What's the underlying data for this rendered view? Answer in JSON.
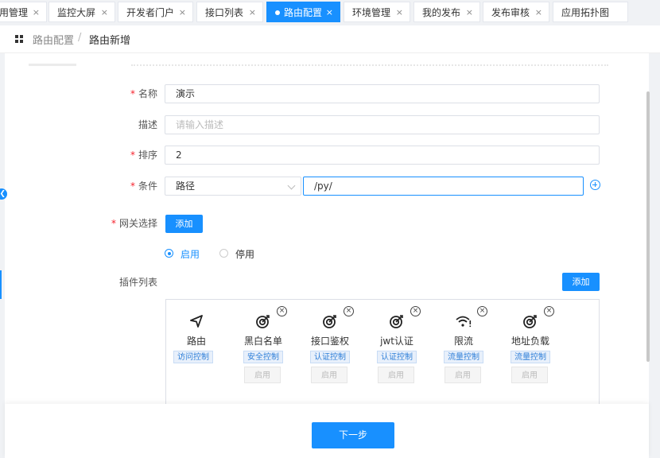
{
  "tabs": [
    {
      "label": "用管理",
      "active": false
    },
    {
      "label": "监控大屏",
      "active": false
    },
    {
      "label": "开发者门户",
      "active": false
    },
    {
      "label": "接口列表",
      "active": false
    },
    {
      "label": "路由配置",
      "active": true
    },
    {
      "label": "环境管理",
      "active": false
    },
    {
      "label": "我的发布",
      "active": false
    },
    {
      "label": "发布审核",
      "active": false
    },
    {
      "label": "应用拓扑图",
      "active": false
    }
  ],
  "tab_close_glyph": "×",
  "breadcrumb": {
    "parent": "路由配置",
    "separator": "/",
    "current": "路由新增"
  },
  "form": {
    "required_mark": "*",
    "name": {
      "label": "名称",
      "value": "演示"
    },
    "desc": {
      "label": "描述",
      "placeholder": "请输入描述"
    },
    "order": {
      "label": "排序",
      "value": "2"
    },
    "condition": {
      "label": "条件",
      "type_value": "路径",
      "path_value": "/py/"
    },
    "gateway": {
      "label": "网关选择",
      "add_label": "添加"
    },
    "status": {
      "enabled_label": "启用",
      "disabled_label": "停用",
      "selected": "启用"
    },
    "plugins": {
      "label": "插件列表",
      "add_label": "添加"
    }
  },
  "plugins": [
    {
      "name": "路由",
      "tag": "访问控制",
      "icon": "navigate-icon",
      "removable": false,
      "enable_button": false
    },
    {
      "name": "黑白名单",
      "tag": "安全控制",
      "icon": "target-icon",
      "removable": true,
      "enable_button": true
    },
    {
      "name": "接口鉴权",
      "tag": "认证控制",
      "icon": "target-icon",
      "removable": true,
      "enable_button": true
    },
    {
      "name": "jwt认证",
      "tag": "认证控制",
      "icon": "target-icon",
      "removable": true,
      "enable_button": true
    },
    {
      "name": "限流",
      "tag": "流量控制",
      "icon": "wifi-alert-icon",
      "removable": true,
      "enable_button": true
    },
    {
      "name": "地址负载",
      "tag": "流量控制",
      "icon": "target-icon",
      "removable": true,
      "enable_button": true
    }
  ],
  "plugin_enable_label": "启用",
  "plugin_close_glyph": "×",
  "footer": {
    "next_label": "下一步"
  },
  "colors": {
    "primary": "#1890ff",
    "required": "#f5222d",
    "tag_text": "#2f7fd8",
    "tag_bg": "#e8f0fb"
  }
}
